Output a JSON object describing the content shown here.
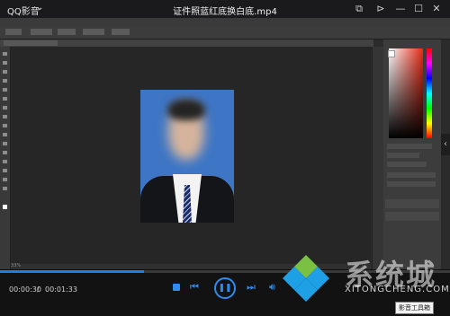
{
  "player": {
    "app_name": "QQ影音",
    "video_title": "证件照蓝红底换白底.mp4",
    "current_time": "00:00:30",
    "time_separator": "/",
    "total_time": "00:01:33",
    "progress": 0.32,
    "icons": [
      "caret-down-icon",
      "screenshot-icon",
      "pin-icon",
      "minimize-icon",
      "maximize-icon",
      "close-icon",
      "stop-icon",
      "previous-icon",
      "pause-icon",
      "next-icon",
      "volume-icon"
    ],
    "accent_color": "#2f8bf0"
  },
  "photoshop": {
    "status_text": "33%"
  },
  "watermark": {
    "title": "系统城",
    "subtitle": "XITONGCHENG.COM"
  },
  "tooltip": {
    "text": "影音工具箱"
  },
  "colors": {
    "photo_background": "#3e76c5",
    "canvas": "#262626",
    "controls_bg": "#121213"
  }
}
